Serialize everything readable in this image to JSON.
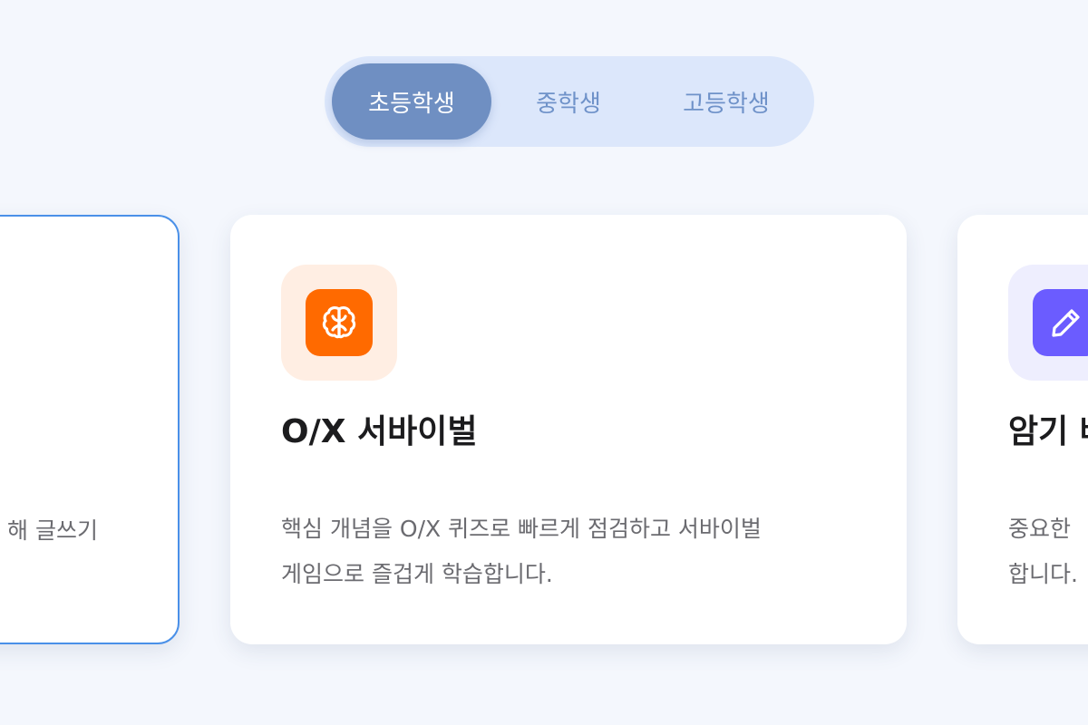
{
  "tabs": [
    {
      "label": "초등학생",
      "active": true
    },
    {
      "label": "중학생",
      "active": false
    },
    {
      "label": "고등학생",
      "active": false
    }
  ],
  "cards": {
    "left": {
      "desc_line1": "해 글쓰기"
    },
    "center": {
      "icon": "brain-icon",
      "icon_color": "#ff6a00",
      "icon_bg": "#ffeee3",
      "title": "O/X 서바이벌",
      "desc_line1": "핵심 개념을 O/X 퀴즈로 빠르게 점검하고 서바이벌",
      "desc_line2": "게임으로 즐겁게 학습합니다."
    },
    "right": {
      "icon": "pencil-icon",
      "icon_color": "#6b5cff",
      "icon_bg": "#eeeefe",
      "title": "암기 배",
      "desc_line1": "중요한 ",
      "desc_line2": "합니다."
    }
  },
  "colors": {
    "accent": "#4a90e8",
    "tab_active": "#6f8fc2",
    "tab_bg": "#dce7fb",
    "background": "#f4f7fd"
  }
}
